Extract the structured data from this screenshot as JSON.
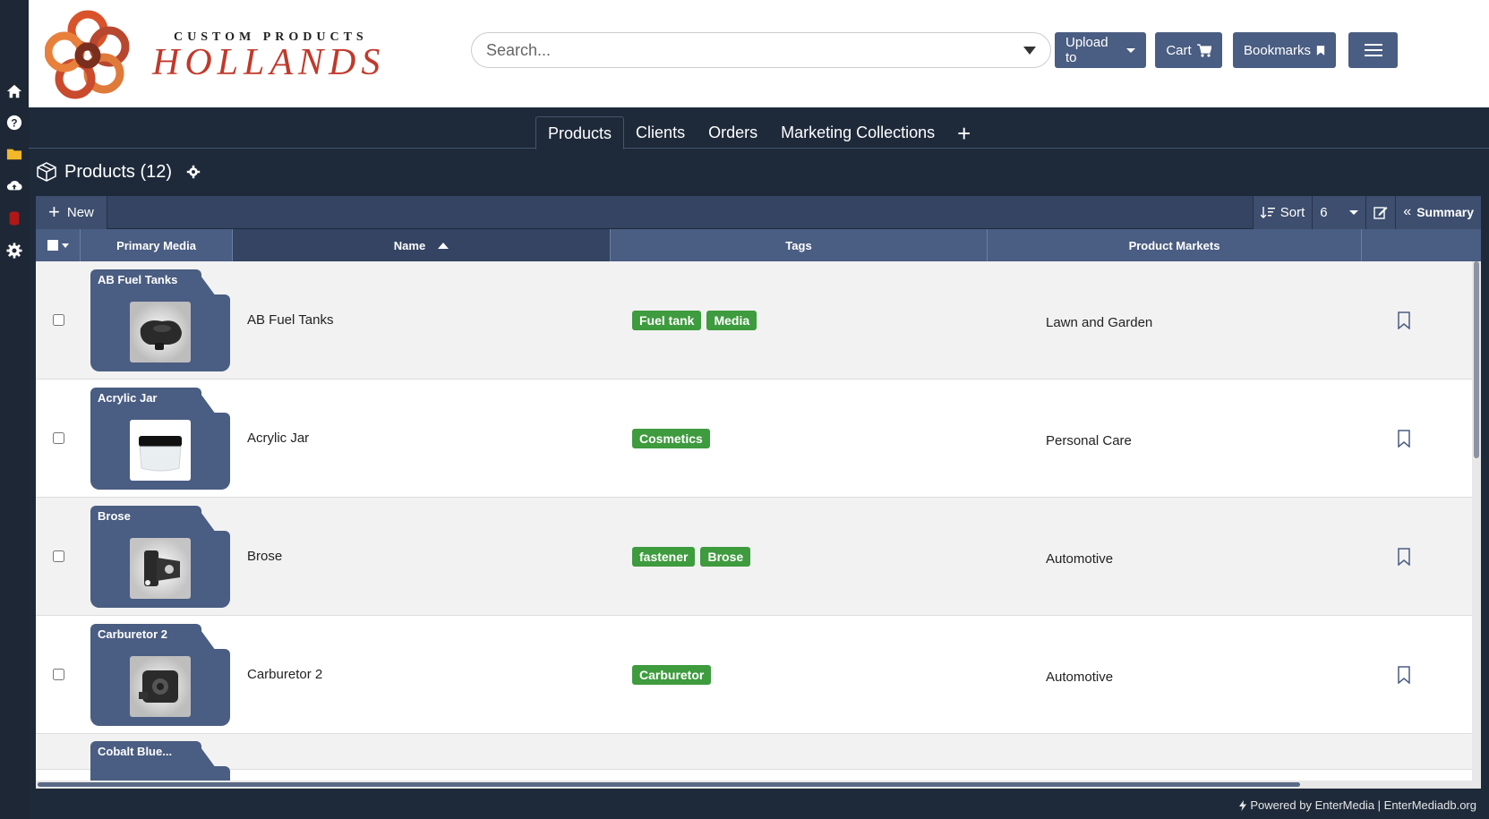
{
  "brand": {
    "sub": "CUSTOM PRODUCTS",
    "name": "HOLLANDS"
  },
  "search": {
    "placeholder": "Search..."
  },
  "header_buttons": {
    "upload": "Upload to",
    "cart": "Cart",
    "bookmarks": "Bookmarks"
  },
  "tabs": [
    {
      "label": "Products",
      "active": true
    },
    {
      "label": "Clients",
      "active": false
    },
    {
      "label": "Orders",
      "active": false
    },
    {
      "label": "Marketing Collections",
      "active": false
    }
  ],
  "section": {
    "title": "Products (12)"
  },
  "toolbar": {
    "new": "New",
    "sort": "Sort",
    "page_size": "6",
    "summary": "Summary"
  },
  "columns": {
    "primary_media": "Primary Media",
    "name": "Name",
    "tags": "Tags",
    "product_markets": "Product Markets"
  },
  "rows": [
    {
      "folder": "AB Fuel Tanks",
      "name": "AB Fuel Tanks",
      "tags": [
        "Fuel tank",
        "Media"
      ],
      "market": "Lawn and Garden",
      "thumb": "fuel-tank-icon"
    },
    {
      "folder": "Acrylic Jar",
      "name": "Acrylic Jar",
      "tags": [
        "Cosmetics"
      ],
      "market": "Personal Care",
      "thumb": "jar-icon"
    },
    {
      "folder": "Brose",
      "name": "Brose",
      "tags": [
        "fastener",
        "Brose"
      ],
      "market": "Automotive",
      "thumb": "fastener-icon"
    },
    {
      "folder": "Carburetor 2",
      "name": "Carburetor 2",
      "tags": [
        "Carburetor"
      ],
      "market": "Automotive",
      "thumb": "carburetor-icon"
    },
    {
      "folder": "Cobalt Blue...",
      "name": "",
      "tags": [],
      "market": "",
      "thumb": ""
    }
  ],
  "footer": {
    "text": "Powered by EnterMedia | EnterMediadb.org"
  },
  "colors": {
    "navy": "#1e2a3a",
    "slate": "#4a5d82",
    "tag_green": "#3e9b3e",
    "brand_red": "#c0392b"
  }
}
